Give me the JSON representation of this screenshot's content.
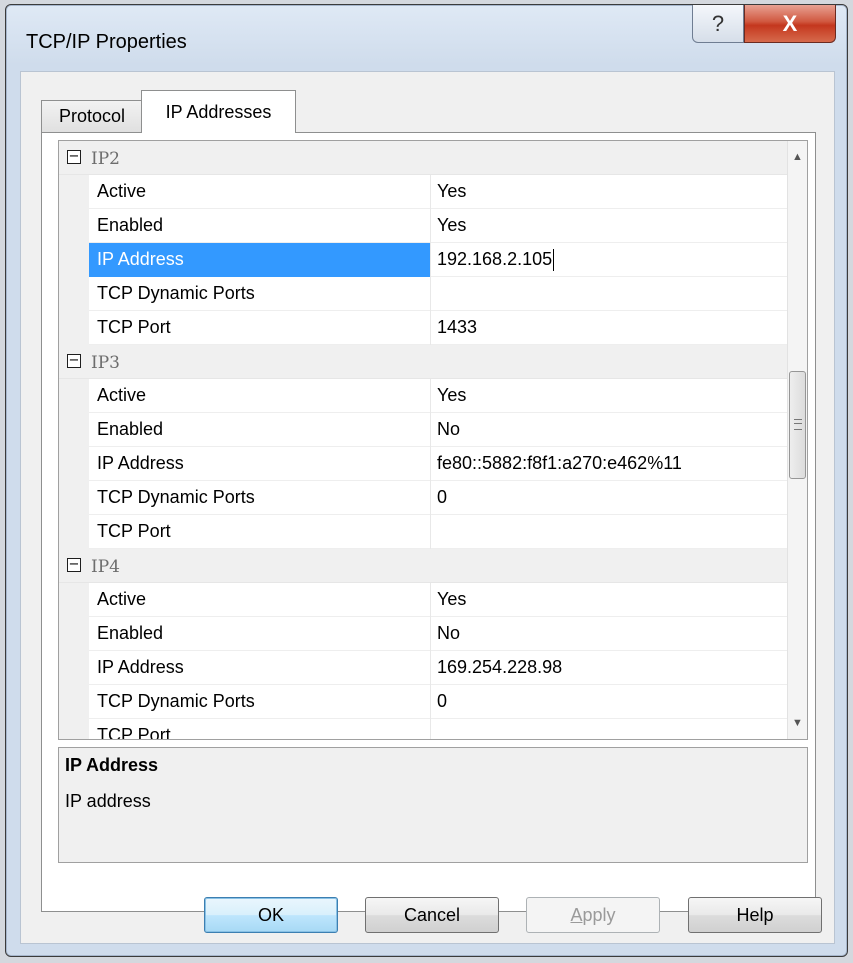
{
  "window": {
    "title": "TCP/IP Properties",
    "help_glyph": "?",
    "close_glyph": "X"
  },
  "tabs": [
    {
      "label": "Protocol",
      "active": false
    },
    {
      "label": "IP Addresses",
      "active": true
    }
  ],
  "grid": {
    "sections": [
      {
        "label": "IP2",
        "expander": "−",
        "rows": [
          {
            "name": "Active",
            "value": "Yes"
          },
          {
            "name": "Enabled",
            "value": "Yes"
          },
          {
            "name": "IP Address",
            "value": "192.168.2.105",
            "selected": true
          },
          {
            "name": "TCP Dynamic Ports",
            "value": ""
          },
          {
            "name": "TCP Port",
            "value": "1433"
          }
        ]
      },
      {
        "label": "IP3",
        "expander": "−",
        "rows": [
          {
            "name": "Active",
            "value": "Yes"
          },
          {
            "name": "Enabled",
            "value": "No"
          },
          {
            "name": "IP Address",
            "value": "fe80::5882:f8f1:a270:e462%11"
          },
          {
            "name": "TCP Dynamic Ports",
            "value": "0"
          },
          {
            "name": "TCP Port",
            "value": ""
          }
        ]
      },
      {
        "label": "IP4",
        "expander": "−",
        "rows": [
          {
            "name": "Active",
            "value": "Yes"
          },
          {
            "name": "Enabled",
            "value": "No"
          },
          {
            "name": "IP Address",
            "value": "169.254.228.98"
          },
          {
            "name": "TCP Dynamic Ports",
            "value": "0"
          },
          {
            "name": "TCP Port",
            "value": ""
          }
        ]
      }
    ]
  },
  "description": {
    "title": "IP Address",
    "text": "IP address"
  },
  "buttons": {
    "ok": "OK",
    "cancel": "Cancel",
    "apply_mnemonic": "A",
    "apply_rest": "pply",
    "help": "Help"
  }
}
